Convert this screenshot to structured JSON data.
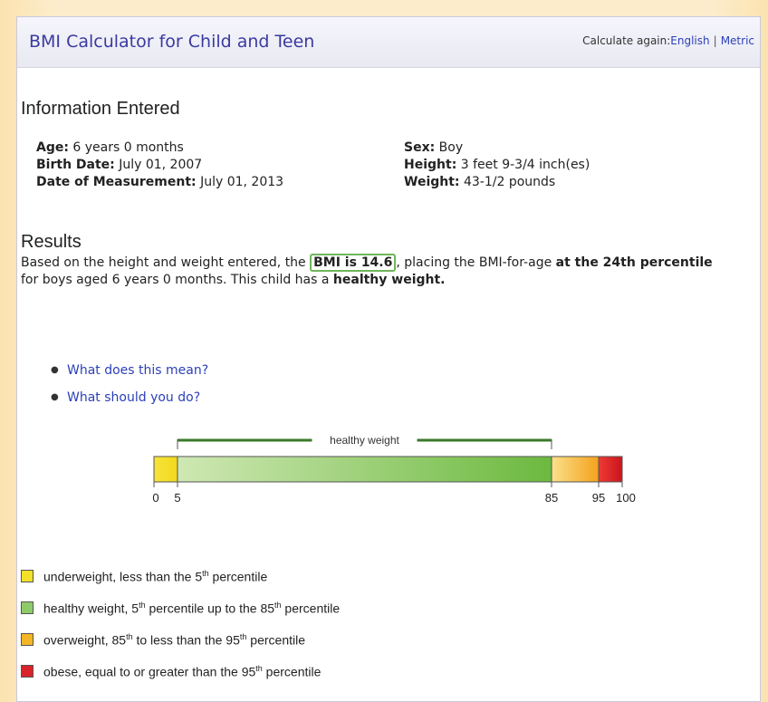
{
  "header": {
    "title": "BMI Calculator for Child and Teen",
    "calc_again_label": "Calculate again:",
    "english_link": "English",
    "separator": "|",
    "metric_link": "Metric"
  },
  "info": {
    "section_title": "Information Entered",
    "age_label": "Age:",
    "age_value": "6 years 0 months",
    "birth_label": "Birth Date:",
    "birth_value": "July 01, 2007",
    "measure_label": "Date of Measurement:",
    "measure_value": "July 01, 2013",
    "sex_label": "Sex:",
    "sex_value": "Boy",
    "height_label": "Height:",
    "height_value": "3 feet 9-3/4 inch(es)",
    "weight_label": "Weight:",
    "weight_value": "43-1/2 pounds"
  },
  "results": {
    "section_title": "Results",
    "text_1": "Based on the height and weight entered, the ",
    "bmi_text": "BMI is 14.6",
    "text_2": ", placing the BMI-for-age ",
    "percentile_text": "at the 24th percentile",
    "text_3": " for boys aged 6 years 0 months. This child has a ",
    "classification": "healthy weight.",
    "link_1": "What does this mean?",
    "link_2": "What should you do?"
  },
  "chart_data": {
    "type": "bar",
    "bracket_label": "healthy weight",
    "range": [
      0,
      100
    ],
    "tick_labels": [
      "0",
      "5",
      "85",
      "95",
      "100"
    ],
    "tick_values": [
      0,
      5,
      85,
      95,
      100
    ],
    "segments": [
      {
        "category": "underweight",
        "from": 0,
        "to": 5,
        "color": "#f7dc2a"
      },
      {
        "category": "healthy weight",
        "from": 5,
        "to": 85,
        "color": "#7cc24b"
      },
      {
        "category": "overweight",
        "from": 85,
        "to": 95,
        "color": "#f6b630"
      },
      {
        "category": "obese",
        "from": 95,
        "to": 100,
        "color": "#d8232a"
      }
    ]
  },
  "legend": [
    {
      "color": "#f2e02a",
      "pre": "underweight, less than the 5",
      "sup": "th",
      "post": " percentile"
    },
    {
      "color": "#8fca6a",
      "pre": "healthy weight, 5",
      "sup": "th",
      "mid": " percentile up to the 85",
      "sup2": "th",
      "post": " percentile"
    },
    {
      "color": "#f4b626",
      "pre": "overweight, 85",
      "sup": "th",
      "post": " to less than the 95",
      "sup2": "th",
      "post2": " percentile"
    },
    {
      "color": "#d8232a",
      "pre": "obese, equal to or greater than the 95",
      "sup": "th",
      "post": " percentile"
    }
  ]
}
